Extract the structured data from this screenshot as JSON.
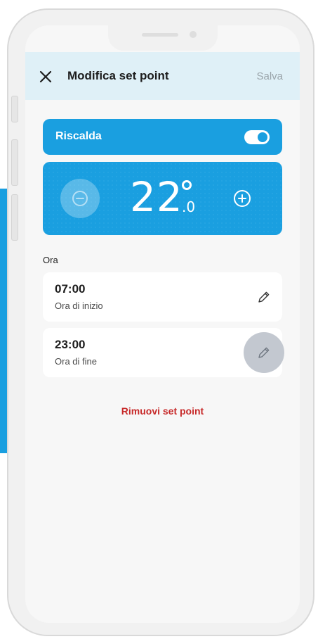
{
  "header": {
    "title": "Modifica set point",
    "save_label": "Salva",
    "close_icon": "close-icon"
  },
  "mode": {
    "label": "Riscalda",
    "enabled": true
  },
  "temperature": {
    "integer": "22",
    "decimal": ".0",
    "decrease_icon": "minus-circle-icon",
    "increase_icon": "plus-circle-icon"
  },
  "schedule": {
    "section_label": "Ora",
    "start": {
      "time": "07:00",
      "label": "Ora di inizio",
      "icon": "pencil-icon"
    },
    "end": {
      "time": "23:00",
      "label": "Ora di fine",
      "icon": "pencil-icon"
    }
  },
  "actions": {
    "remove_label": "Rimuovi set point"
  },
  "colors": {
    "accent": "#1a9fe0",
    "header_bg": "#dff0f7",
    "danger": "#c72a2a"
  }
}
